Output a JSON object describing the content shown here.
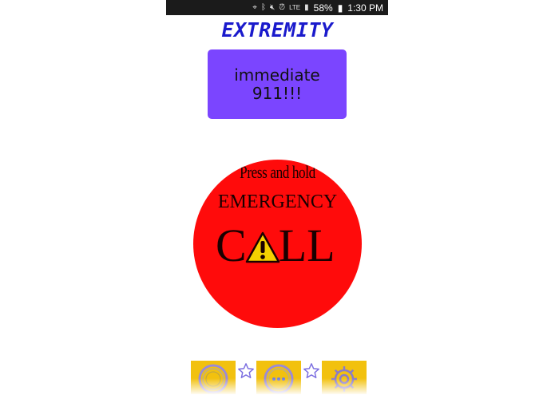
{
  "status_bar": {
    "network": "LTE",
    "battery": "58%",
    "time": "1:30 PM"
  },
  "app": {
    "title": "EXTREMITY"
  },
  "immediate_button": {
    "line1": "immediate",
    "line2": "911!!!"
  },
  "emergency_button": {
    "top_text": "Press and hold",
    "middle_text": "EMERGENCY",
    "call_left": "C",
    "call_right": "LL"
  },
  "bottom_nav": {
    "items": [
      "timer-icon",
      "chat-icon",
      "gear-icon"
    ]
  },
  "colors": {
    "title": "#1a1acc",
    "immediate_bg": "#7b45ff",
    "emergency_bg": "#ff0b0b",
    "nav_tile": "#f2c10e"
  }
}
